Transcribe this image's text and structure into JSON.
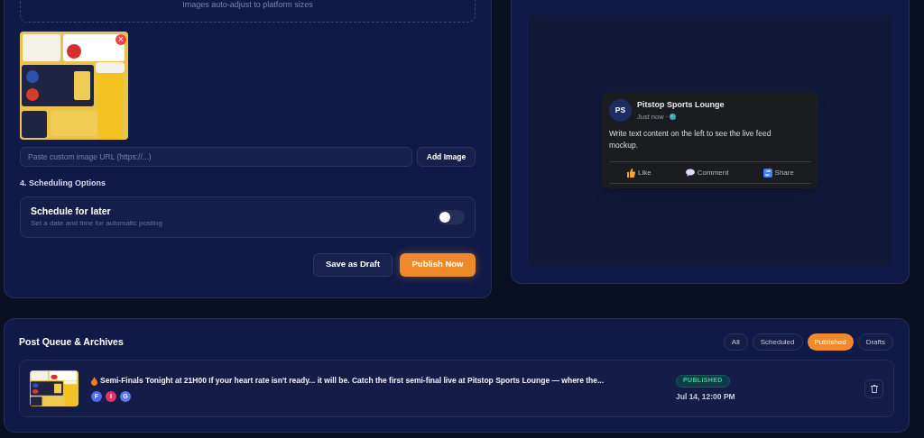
{
  "upload": {
    "hint": "Images auto-adjust to platform sizes"
  },
  "attached_image": {
    "remove": "×"
  },
  "image_url": {
    "placeholder": "Paste custom image URL (https://...)",
    "button": "Add Image"
  },
  "scheduling": {
    "heading": "4. Scheduling Options",
    "title": "Schedule for later",
    "subtitle": "Set a date and time for automatic posting",
    "on": false
  },
  "actions": [
    "Save as Draft",
    "Publish Now"
  ],
  "preview": {
    "avatar": "PS",
    "name": "Pitstop Sports Lounge",
    "time": "Just now ·",
    "text": "Write text content on the left to see the live feed mockup.",
    "actions": [
      {
        "kind": "like",
        "label": "Like"
      },
      {
        "kind": "comment",
        "label": "Comment"
      },
      {
        "kind": "share",
        "label": "Share"
      }
    ]
  },
  "queue": {
    "title": "Post Queue & Archives",
    "filters": [
      {
        "label": "All",
        "selected": false
      },
      {
        "label": "Scheduled",
        "selected": false
      },
      {
        "label": "Published",
        "selected": true
      },
      {
        "label": "Drafts",
        "selected": false
      }
    ],
    "posts": [
      {
        "text": "Semi-Finals Tonight at 21H00 If your heart rate isn't ready... it will be. Catch the first semi-final live at Pitstop Sports Lounge — where the...",
        "platforms": [
          {
            "letter": "F",
            "color": "#4f6cf0"
          },
          {
            "letter": "I",
            "color": "#e0336b"
          },
          {
            "letter": "G",
            "color": "#5b78e6"
          }
        ],
        "status": "PUBLISHED",
        "date": "Jul 14, 12:00 PM"
      }
    ]
  }
}
